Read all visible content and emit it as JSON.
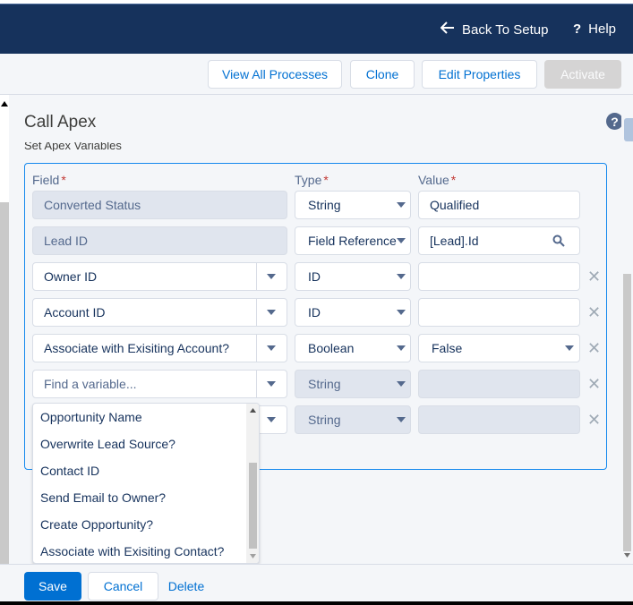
{
  "header": {
    "back_label": "Back To Setup",
    "help_label": "Help"
  },
  "toolbar": {
    "view_all": "View All Processes",
    "clone": "Clone",
    "edit_properties": "Edit Properties",
    "activate": "Activate"
  },
  "panel": {
    "title": "Call Apex",
    "section_label": "Set Apex Variables"
  },
  "columns": {
    "field": "Field",
    "type": "Type",
    "value": "Value",
    "required_mark": "*"
  },
  "rows": [
    {
      "field": "Converted Status",
      "type": "String",
      "value": "Qualified"
    },
    {
      "field": "Lead ID",
      "type": "Field Reference",
      "value": "[Lead].Id"
    },
    {
      "field": "Owner ID",
      "type": "ID",
      "value": ""
    },
    {
      "field": "Account ID",
      "type": "ID",
      "value": ""
    },
    {
      "field": "Associate with Exisiting Account?",
      "type": "Boolean",
      "value": "False"
    },
    {
      "field_placeholder": "Find a variable...",
      "type": "String",
      "value": ""
    },
    {
      "field": "",
      "type": "String",
      "value": ""
    }
  ],
  "dropdown": {
    "items": [
      "Opportunity Name",
      "Overwrite Lead Source?",
      "Contact ID",
      "Send Email to Owner?",
      "Create Opportunity?",
      "Associate with Exisiting Contact?"
    ]
  },
  "footer": {
    "save": "Save",
    "cancel": "Cancel",
    "delete": "Delete"
  },
  "colors": {
    "header_bg": "#16325c",
    "brand_blue": "#0070d2",
    "focus_border": "#1589ee"
  }
}
